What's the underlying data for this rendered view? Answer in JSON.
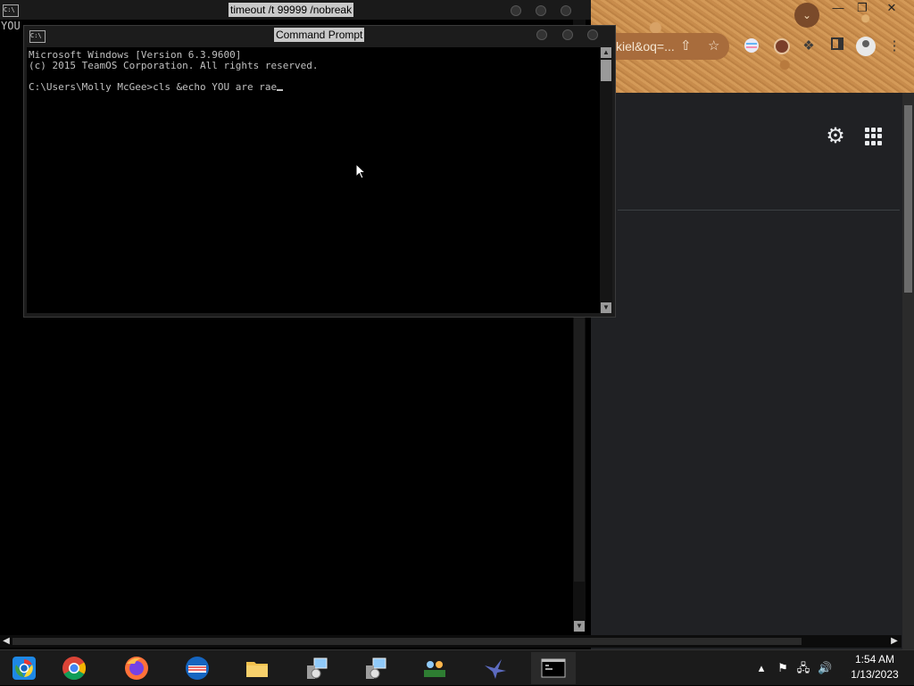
{
  "chrome": {
    "omnibox_text": "kiel&oq=...",
    "window_controls": [
      "—",
      "❐",
      "✕"
    ],
    "icons": [
      "chevron-down-icon",
      "share-icon",
      "star-icon",
      "extension-icon",
      "sidebar-icon",
      "account-icon",
      "kebab-menu-icon",
      "settings-icon",
      "apps-grid-icon"
    ]
  },
  "bg_console": {
    "title": "timeout  /t 99999 /nobreak",
    "output": "YOU"
  },
  "cmd": {
    "title": "Command Prompt",
    "lines": [
      "Microsoft Windows [Version 6.3.9600]",
      "(c) 2015 TeamOS Corporation. All rights reserved.",
      "",
      "C:\\Users\\Molly McGee>cls &echo YOU are rae"
    ]
  },
  "taskbar": {
    "apps": [
      "Chrome (legacy)",
      "Google Chrome",
      "Firefox",
      "Outlook",
      "File Explorer",
      "Network Setup",
      "Network Setup",
      "Network Users",
      "Bird App",
      "Command Prompt"
    ],
    "clock_time": "1:54 AM",
    "clock_date": "1/13/2023"
  }
}
